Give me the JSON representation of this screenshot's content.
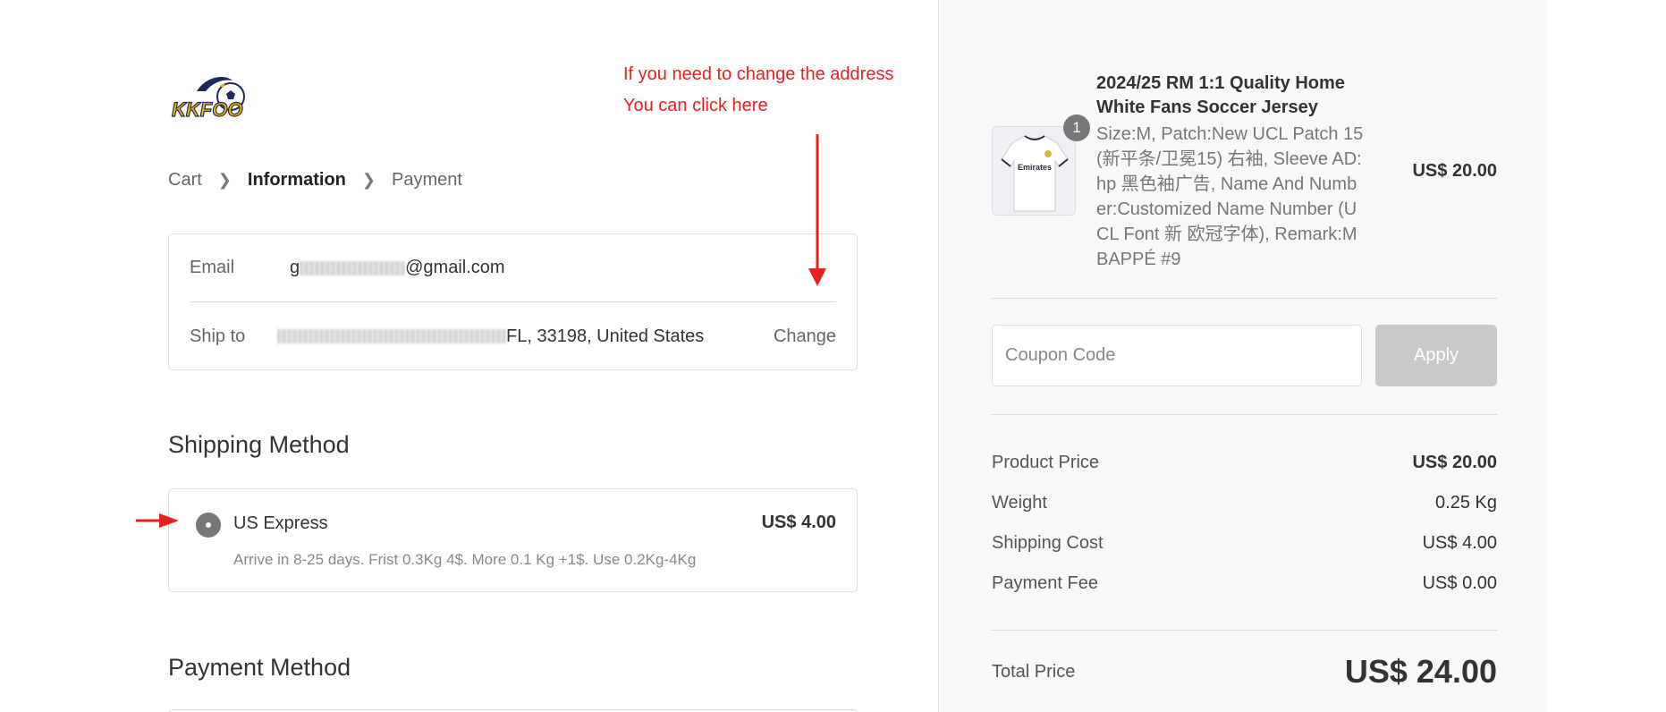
{
  "annotation": {
    "line1": "If you need to change the address",
    "line2": "You can click here"
  },
  "brand": {
    "logo_text": "KKFOO"
  },
  "breadcrumb": {
    "step1": "Cart",
    "step2": "Information",
    "step3": "Payment"
  },
  "info": {
    "email_label": "Email",
    "email_prefix": "g",
    "email_suffix": "@gmail.com",
    "ship_label": "Ship to",
    "ship_suffix": "FL, 33198, United States",
    "change_label": "Change"
  },
  "shipping": {
    "title": "Shipping Method",
    "option_name": "US Express",
    "option_price": "US$ 4.00",
    "option_desc": "Arrive in 8-25 days. Frist 0.3Kg 4$. More 0.1 Kg +1$. Use 0.2Kg-4Kg"
  },
  "payment": {
    "title": "Payment Method"
  },
  "order": {
    "product_title": "2024/25 RM 1:1 Quality Home White Fans Soccer Jersey",
    "product_spec": "Size:M, Patch:New UCL Patch 15 (新平条/卫冕15) 右袖, Sleeve AD:hp 黑色袖广告, Name And Number:Customized Name Number (UCL Font 新 欧冠字体), Remark:MBAPPÉ #9",
    "product_price": "US$ 20.00",
    "quantity": "1",
    "jersey_sponsor": "Emirates",
    "coupon_placeholder": "Coupon Code",
    "apply_label": "Apply",
    "product_price_label": "Product Price",
    "product_price_value": "US$ 20.00",
    "weight_label": "Weight",
    "weight_value": "0.25 Kg",
    "shipping_label": "Shipping Cost",
    "shipping_value": "US$ 4.00",
    "fee_label": "Payment Fee",
    "fee_value": "US$ 0.00",
    "total_label": "Total Price",
    "total_value": "US$ 24.00"
  },
  "colors": {
    "annotation": "#e8201e",
    "apply_bg": "#c9c9c9",
    "sidebar_bg": "#f8f8f8"
  }
}
